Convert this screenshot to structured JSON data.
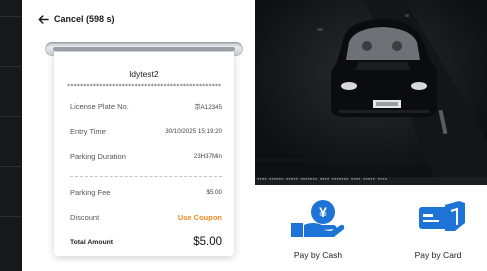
{
  "header": {
    "cancel_label": "Cancel (598 s)"
  },
  "receipt": {
    "title": "ldytest2",
    "separator": "************************************************",
    "rows": {
      "license_plate": {
        "label": "License Plate No.",
        "value": "京A12345"
      },
      "entry_time": {
        "label": "Entry Time",
        "value": "30/10/2025 15:19:20"
      },
      "parking_duration": {
        "label": "Parking Duration",
        "value": "23H37Min"
      },
      "parking_fee": {
        "label": "Parking Fee",
        "value": "$5.00"
      },
      "discount": {
        "label": "Discount",
        "value": "Use Coupon"
      },
      "total": {
        "label": "Total Amount",
        "value": "$5.00"
      }
    }
  },
  "payment": {
    "cash_label": "Pay by Cash",
    "card_label": "Pay by Card"
  },
  "colors": {
    "accent_blue": "#1e74d6",
    "coupon_orange": "#f08b1e",
    "dark_bg": "#1b1d21"
  },
  "icons": {
    "back": "arrow-left-icon",
    "cash": "cash-hand-icon",
    "card": "card-hand-icon"
  }
}
